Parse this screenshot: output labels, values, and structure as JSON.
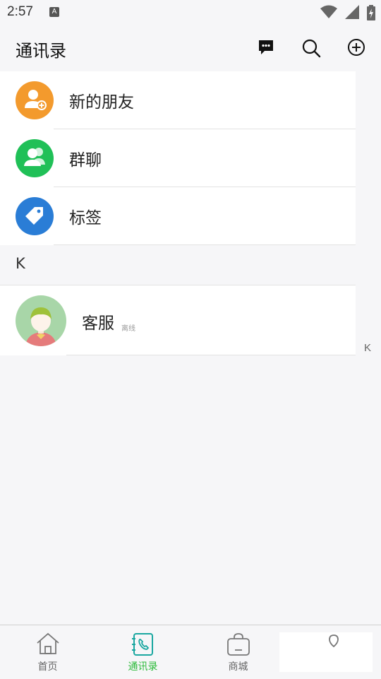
{
  "status_bar": {
    "time": "2:57",
    "notification_badge": "A"
  },
  "header": {
    "title": "通讯录",
    "icons": [
      "chat-bubble-icon",
      "search-icon",
      "add-circle-icon"
    ]
  },
  "function_items": [
    {
      "label": "新的朋友",
      "icon": "add-friend-icon",
      "color": "#f39a2d"
    },
    {
      "label": "群聊",
      "icon": "group-chat-icon",
      "color": "#20c057"
    },
    {
      "label": "标签",
      "icon": "tag-icon",
      "color": "#2a7dd6"
    }
  ],
  "section": {
    "letter": "K"
  },
  "contacts": [
    {
      "name": "客服",
      "status": "离线"
    }
  ],
  "index_bar": [
    "K"
  ],
  "bottom_nav": [
    {
      "label": "首页",
      "icon": "home-icon",
      "active": false
    },
    {
      "label": "通讯录",
      "icon": "contacts-icon",
      "active": true
    },
    {
      "label": "商城",
      "icon": "shopping-bag-icon",
      "active": false
    },
    {
      "label": "",
      "icon": "profile-icon",
      "active": false
    }
  ],
  "colors": {
    "accent": "#2dbb3b",
    "background": "#f6f6f8",
    "active_nav": "#2dbb3b"
  }
}
